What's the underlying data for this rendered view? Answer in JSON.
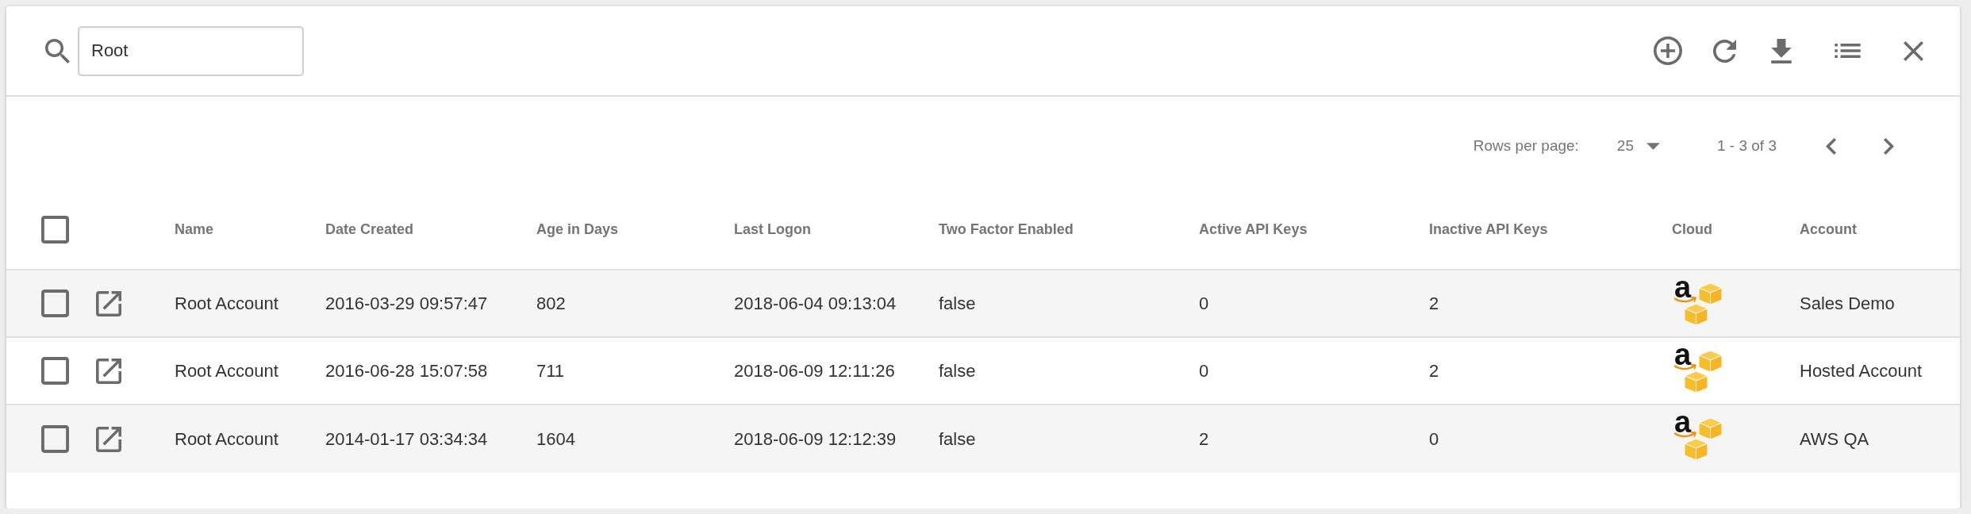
{
  "toolbar": {
    "search": {
      "value": "Root"
    }
  },
  "pagination": {
    "rows_per_page_label": "Rows per page:",
    "rows_per_page": "25",
    "range": "1 - 3 of 3"
  },
  "table": {
    "select_all": {
      "checked": false
    },
    "columns": [
      "Name",
      "Date Created",
      "Age in Days",
      "Last Logon",
      "Two Factor Enabled",
      "Active API Keys",
      "Inactive API Keys",
      "Cloud",
      "Account"
    ],
    "rows": [
      {
        "checked": false,
        "name": "Root Account",
        "date_created": "2016-03-29 09:57:47",
        "age_in_days": "802",
        "last_logon": "2018-06-04 09:13:04",
        "two_factor_enabled": "false",
        "active_api_keys": "0",
        "inactive_api_keys": "2",
        "cloud": {
          "kind": "aws",
          "logo_text": "a"
        },
        "account": "Sales Demo"
      },
      {
        "checked": false,
        "name": "Root Account",
        "date_created": "2016-06-28 15:07:58",
        "age_in_days": "711",
        "last_logon": "2018-06-09 12:11:26",
        "two_factor_enabled": "false",
        "active_api_keys": "0",
        "inactive_api_keys": "2",
        "cloud": {
          "kind": "aws",
          "logo_text": "a"
        },
        "account": "Hosted Account"
      },
      {
        "checked": false,
        "name": "Root Account",
        "date_created": "2014-01-17 03:34:34",
        "age_in_days": "1604",
        "last_logon": "2018-06-09 12:12:39",
        "two_factor_enabled": "false",
        "active_api_keys": "2",
        "inactive_api_keys": "0",
        "cloud": {
          "kind": "aws",
          "logo_text": "a"
        },
        "account": "AWS QA"
      }
    ]
  }
}
